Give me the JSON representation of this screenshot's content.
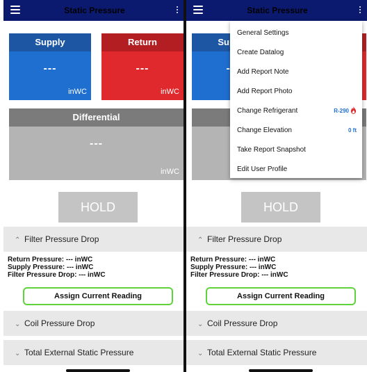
{
  "app": {
    "title": "Static Pressure"
  },
  "tiles": {
    "supply": {
      "label": "Supply",
      "value": "---",
      "unit": "inWC"
    },
    "return": {
      "label": "Return",
      "value": "---",
      "unit": "inWC"
    },
    "differential": {
      "label": "Differential",
      "value": "---",
      "unit": "inWC"
    }
  },
  "hold_label": "HOLD",
  "sections": {
    "filter": {
      "label": "Filter Pressure Drop",
      "chevron": "^"
    },
    "coil": {
      "label": "Coil Pressure Drop",
      "chevron": "v"
    },
    "tesp": {
      "label": "Total External Static Pressure",
      "chevron": "v"
    }
  },
  "readings": {
    "return": "Return Pressure: --- inWC",
    "supply": "Supply Pressure: --- inWC",
    "filter": "Filter Pressure Drop: --- inWC"
  },
  "assign_label": "Assign Current Reading",
  "menu": {
    "items": [
      {
        "label": "General Settings"
      },
      {
        "label": "Create Datalog"
      },
      {
        "label": "Add Report Note"
      },
      {
        "label": "Add Report Photo"
      },
      {
        "label": "Change Refrigerant",
        "value": "R-290"
      },
      {
        "label": "Change Elevation",
        "value": "0 ft"
      },
      {
        "label": "Take Report Snapshot"
      },
      {
        "label": "Edit User Profile"
      }
    ]
  },
  "colors": {
    "appbar": "#0b1a6e",
    "supply": "#1f6fd1",
    "return": "#e0292c",
    "differential": "#b4b4b4",
    "assign_border": "#5ed33b"
  }
}
